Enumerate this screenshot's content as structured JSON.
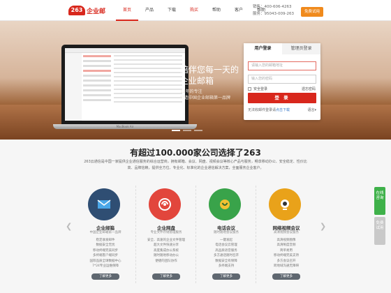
{
  "header": {
    "logo_mark": "263",
    "logo_text": "企业邮",
    "nav": [
      "首页",
      "产品",
      "下载",
      "购买",
      "帮助",
      "客户",
      "帮助"
    ],
    "contact_sales": "销售：400-606-4263",
    "contact_service": "服务：95043-009-263",
    "trial_button": "免费试用"
  },
  "hero": {
    "slogan_line1": "陪伴您每一天的",
    "slogan_line2": "企业邮箱",
    "slogan_sub1": "12年的专注",
    "slogan_sub2": "打造中国企业邮箱第一品牌",
    "laptop_brand": "MacBook Air"
  },
  "login": {
    "tab_user": "用户登录",
    "tab_admin": "管理员登录",
    "email_placeholder": "请输入您的邮箱地址",
    "password_placeholder": "输入您的密码",
    "remember_label": "安全登录",
    "forgot_label": "遗忘密码",
    "login_button": "登 录",
    "footer_text": "无法收邮件登录请",
    "footer_link": "点击下载",
    "language": "语言▾"
  },
  "headline": "有超过100.000家公司选择了263",
  "intro": "263云通信是中国一家提供企业通信服务的综合运营商，拥有邮箱、会议、网盘、视频会议等核心产品与服务，畅享移动办公、安全稳定、性价比高、品牌信赖，提供全方位、专业化、标准化的企业通信解决方案，全面服务企业客户。",
  "cards": [
    {
      "title": "企业邮箱",
      "subtitle": "中国企业邮箱第一品牌",
      "lines": [
        "稳定收发邮件",
        "数据安全无忧",
        "移动终端完美同步",
        "多终端客户端同步",
        "国际品质全球数据中心",
        "7*24专业运维保障"
      ],
      "button": "了解更多",
      "color": "#2f4e73"
    },
    {
      "title": "企业网盘",
      "subtitle": "专业文件存储管理服务",
      "lines": [
        "安全、高速的企业文件管理",
        "超大文件快速分享",
        "高度集成办公系统",
        "随时随地移动办公",
        "便捷的团队协作"
      ],
      "button": "了解更多",
      "color": "#e2463c"
    },
    {
      "title": "电话会议",
      "subtitle": "随时随地会议服务",
      "lines": [
        "一键发起",
        "电话会议云管理",
        "高品质语音服务",
        "多方通话随时召开",
        "数据安全有保障",
        "多终端支持"
      ],
      "button": "了解更多",
      "color": "#39a34a"
    },
    {
      "title": "网络视频会议",
      "subtitle": "高清视频会议服务",
      "lines": [
        "高清视频图像",
        "高清晰度音频",
        "简单易用",
        "移动终端完美支持",
        "多方会议召开",
        "跨地域沟通无障碍"
      ],
      "button": "了解更多",
      "color": "#e9a21a"
    }
  ],
  "side": {
    "online": "在线咨询",
    "free": "免费试用"
  }
}
